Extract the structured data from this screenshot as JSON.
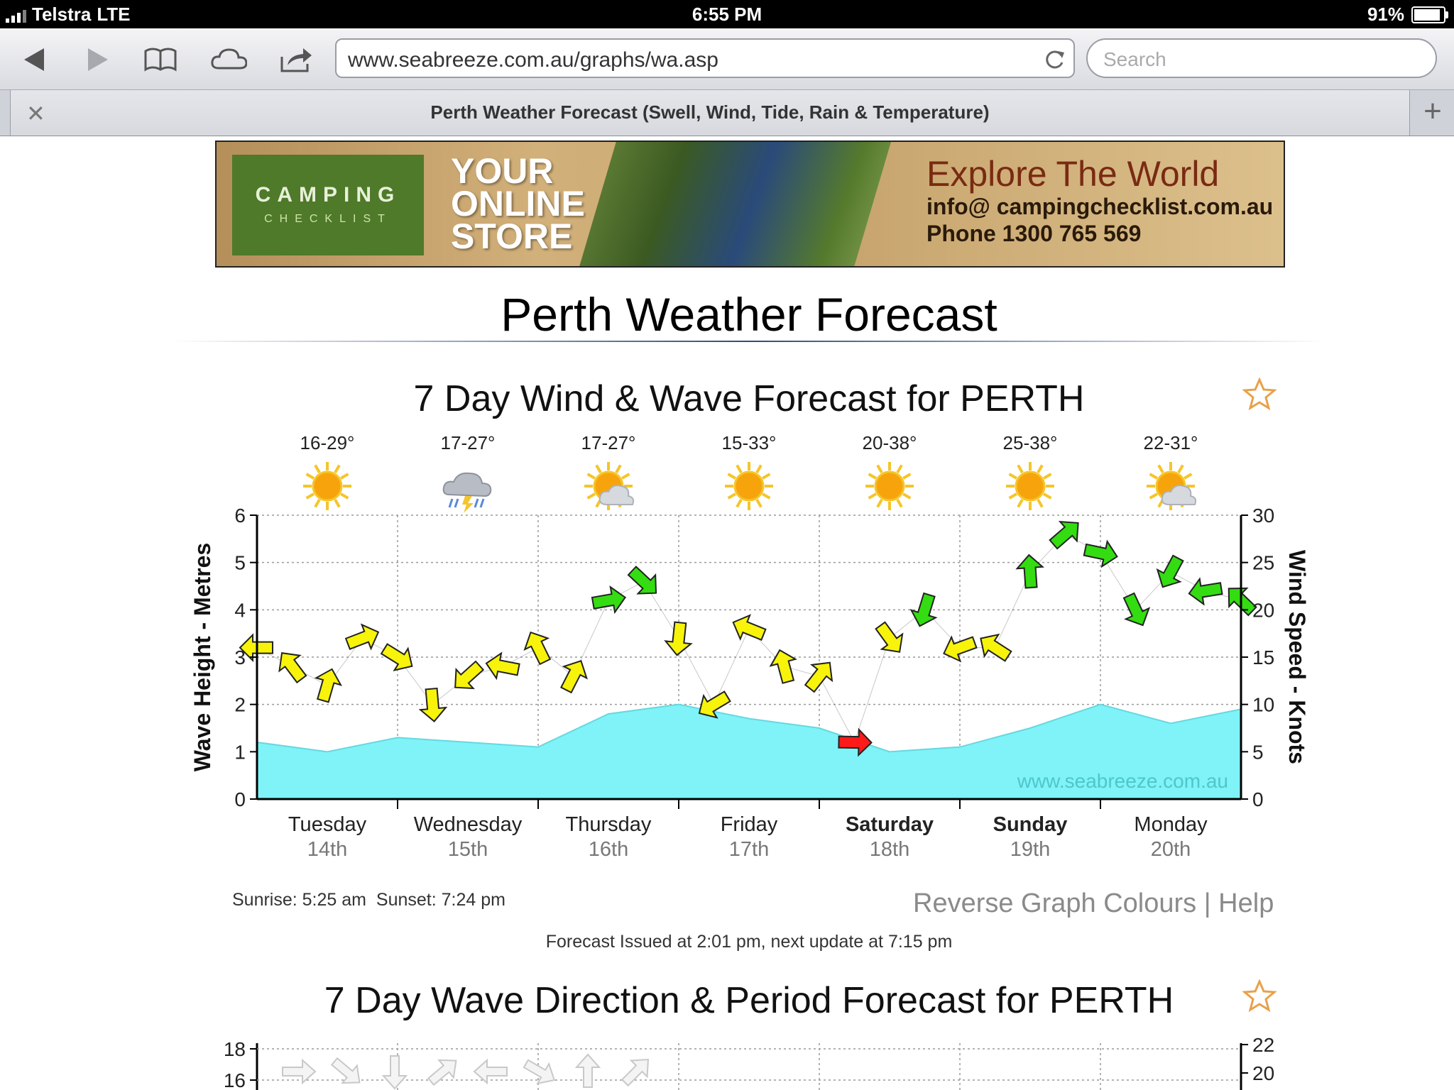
{
  "status": {
    "carrier": "Telstra",
    "network": "LTE",
    "time": "6:55 PM",
    "battery": "91%"
  },
  "browser": {
    "url": "www.seabreeze.com.au/graphs/wa.asp",
    "search_placeholder": "Search",
    "tab_title": "Perth Weather Forecast (Swell, Wind, Tide, Rain & Temperature)"
  },
  "ad": {
    "logo_line1": "CAMPING",
    "logo_line2": "CHECKLIST",
    "store": [
      "YOUR",
      "ONLINE",
      "STORE"
    ],
    "headline": "Explore The World",
    "email": "info@ campingchecklist.com.au",
    "phone": "Phone 1300 765 569"
  },
  "page": {
    "title": "Perth Weather Forecast"
  },
  "chart_data": [
    {
      "type": "area",
      "title": "7 Day Wind & Wave Forecast for PERTH",
      "ylabel": "Wave Height - Metres",
      "y2label": "Wind Speed - Knots",
      "ylim": [
        0,
        6
      ],
      "y2lim": [
        0,
        30
      ],
      "yticks": [
        0,
        1,
        2,
        3,
        4,
        5,
        6
      ],
      "y2ticks": [
        0,
        5,
        10,
        15,
        20,
        25,
        30
      ],
      "watermark": "www.seabreeze.com.au",
      "grid": true,
      "days": [
        {
          "day": "Tuesday",
          "date": "14th",
          "temp": "16-29°",
          "icon": "sun-icon",
          "bold": false
        },
        {
          "day": "Wednesday",
          "date": "15th",
          "temp": "17-27°",
          "icon": "storm-cloud-icon",
          "bold": false
        },
        {
          "day": "Thursday",
          "date": "16th",
          "temp": "17-27°",
          "icon": "partly-cloudy-icon",
          "bold": false
        },
        {
          "day": "Friday",
          "date": "17th",
          "temp": "15-33°",
          "icon": "sun-icon",
          "bold": false
        },
        {
          "day": "Saturday",
          "date": "18th",
          "temp": "20-38°",
          "icon": "sun-icon",
          "bold": true
        },
        {
          "day": "Sunday",
          "date": "19th",
          "temp": "25-38°",
          "icon": "sun-icon",
          "bold": true
        },
        {
          "day": "Monday",
          "date": "20th",
          "temp": "22-31°",
          "icon": "partly-cloudy-icon",
          "bold": false
        }
      ],
      "series": [
        {
          "name": "Wave Height",
          "axis": "left",
          "color": "#7ff3f7",
          "x": [
            0,
            0.5,
            1,
            1.5,
            2,
            2.5,
            3,
            3.5,
            4,
            4.5,
            5,
            5.5,
            6,
            6.5,
            7
          ],
          "values": [
            1.2,
            1.0,
            1.3,
            1.2,
            1.1,
            1.8,
            2.0,
            1.7,
            1.5,
            1.0,
            1.1,
            1.5,
            2.0,
            1.6,
            1.9
          ]
        },
        {
          "name": "Wind Speed",
          "axis": "right",
          "x": [
            0,
            0.25,
            0.5,
            0.75,
            1,
            1.25,
            1.5,
            1.75,
            2,
            2.25,
            2.5,
            2.75,
            3,
            3.25,
            3.5,
            3.75,
            4,
            4.25,
            4.5,
            4.75,
            5,
            5.25,
            5.5,
            5.75,
            6,
            6.25,
            6.5,
            6.75,
            7
          ],
          "values": [
            16,
            14,
            12,
            17,
            15,
            10,
            13,
            14,
            16,
            13,
            21,
            23,
            17,
            10,
            18,
            14,
            13,
            6,
            17,
            20,
            16,
            16,
            24,
            28,
            26,
            20,
            24,
            22,
            21
          ],
          "colors": {
            "low": "#ff1a1a",
            "mid": "#f7f30a",
            "high": "#33dd11"
          }
        }
      ]
    },
    {
      "type": "line",
      "title": "7 Day Wave Direction & Period Forecast for PERTH",
      "yticks": [
        16,
        18
      ],
      "y2ticks": [
        20,
        22
      ]
    }
  ],
  "info": {
    "sunrise": "Sunrise: 5:25 am",
    "sunset": "Sunset: 7:24 pm",
    "reverse": "Reverse Graph Colours",
    "sep": "|",
    "help": "Help",
    "issued": "Forecast Issued at 2:01 pm, next update at 7:15 pm"
  }
}
